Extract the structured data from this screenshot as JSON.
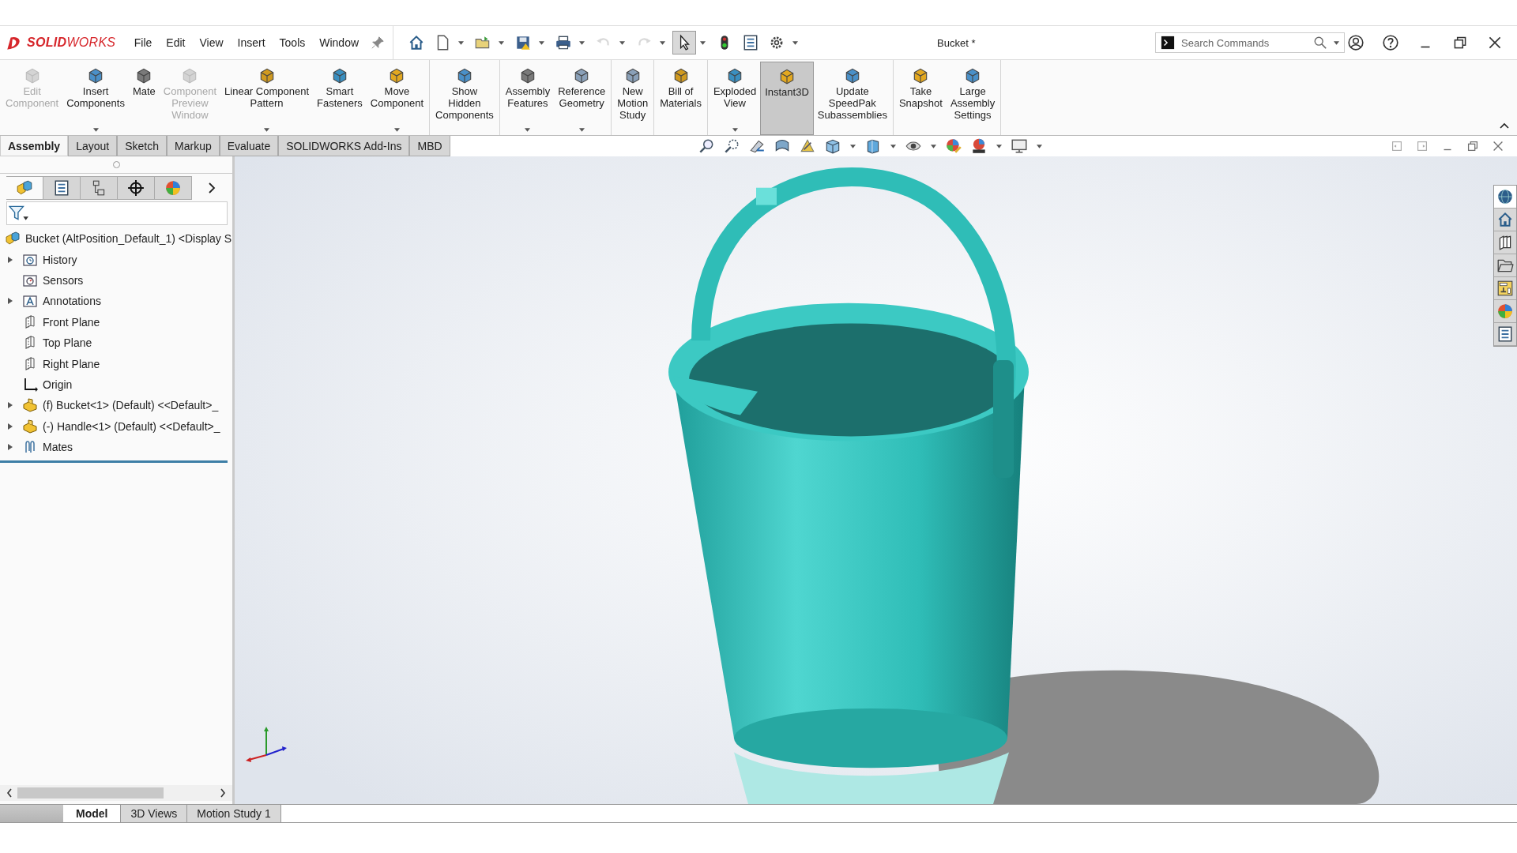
{
  "app": {
    "logo": "**SOLID**WORKS"
  },
  "menu": [
    "File",
    "Edit",
    "View",
    "Insert",
    "Tools",
    "Window"
  ],
  "quick_access": [
    {
      "kind": "home",
      "dropdown": false,
      "disabled": false,
      "selected": false
    },
    {
      "kind": "new-file",
      "dropdown": true,
      "disabled": false,
      "selected": false
    },
    {
      "kind": "open-folder",
      "dropdown": true,
      "disabled": false,
      "selected": false
    },
    {
      "kind": "save",
      "dropdown": true,
      "disabled": false,
      "selected": false
    },
    {
      "kind": "print",
      "dropdown": true,
      "disabled": false,
      "selected": false
    },
    {
      "kind": "undo",
      "dropdown": true,
      "disabled": true,
      "selected": false
    },
    {
      "kind": "redo",
      "dropdown": true,
      "disabled": true,
      "selected": false
    },
    {
      "kind": "pointer",
      "dropdown": true,
      "disabled": false,
      "selected": true
    },
    {
      "kind": "traffic-light",
      "dropdown": false,
      "disabled": false,
      "selected": false
    },
    {
      "kind": "list",
      "dropdown": false,
      "disabled": false,
      "selected": false
    },
    {
      "kind": "gear",
      "dropdown": true,
      "disabled": false,
      "selected": false
    }
  ],
  "document_title": "Bucket *",
  "search": {
    "placeholder": "Search Commands"
  },
  "window_controls": [
    {
      "kind": "user"
    },
    {
      "kind": "help"
    },
    {
      "kind": "minimize"
    },
    {
      "kind": "restore"
    },
    {
      "kind": "close"
    }
  ],
  "ribbon": {
    "groups": [
      [
        {
          "label": "Edit\nComponent",
          "disabled": true,
          "selected": false,
          "dropdown": false
        },
        {
          "label": "Insert\nComponents",
          "disabled": false,
          "selected": false,
          "dropdown": true
        },
        {
          "label": "Mate",
          "disabled": false,
          "selected": false,
          "dropdown": false
        },
        {
          "label": "Component\nPreview\nWindow",
          "disabled": true,
          "selected": false,
          "dropdown": false
        },
        {
          "label": "Linear Component\nPattern",
          "disabled": false,
          "selected": false,
          "dropdown": true
        },
        {
          "label": "Smart\nFasteners",
          "disabled": false,
          "selected": false,
          "dropdown": false
        },
        {
          "label": "Move\nComponent",
          "disabled": false,
          "selected": false,
          "dropdown": true
        }
      ],
      [
        {
          "label": "Show\nHidden\nComponents",
          "disabled": false,
          "selected": false,
          "dropdown": false
        }
      ],
      [
        {
          "label": "Assembly\nFeatures",
          "disabled": false,
          "selected": false,
          "dropdown": true
        },
        {
          "label": "Reference\nGeometry",
          "disabled": false,
          "selected": false,
          "dropdown": true
        }
      ],
      [
        {
          "label": "New\nMotion\nStudy",
          "disabled": false,
          "selected": false,
          "dropdown": false
        }
      ],
      [
        {
          "label": "Bill of\nMaterials",
          "disabled": false,
          "selected": false,
          "dropdown": false
        }
      ],
      [
        {
          "label": "Exploded\nView",
          "disabled": false,
          "selected": false,
          "dropdown": true
        },
        {
          "label": "Instant3D",
          "disabled": false,
          "selected": true,
          "dropdown": false
        },
        {
          "label": "Update\nSpeedPak\nSubassemblies",
          "disabled": false,
          "selected": false,
          "dropdown": false
        }
      ],
      [
        {
          "label": "Take\nSnapshot",
          "disabled": false,
          "selected": false,
          "dropdown": false
        },
        {
          "label": "Large\nAssembly\nSettings",
          "disabled": false,
          "selected": false,
          "dropdown": false
        }
      ]
    ]
  },
  "ribbon_tabs": [
    {
      "label": "Assembly",
      "selected": true
    },
    {
      "label": "Layout",
      "selected": false
    },
    {
      "label": "Sketch",
      "selected": false
    },
    {
      "label": "Markup",
      "selected": false
    },
    {
      "label": "Evaluate",
      "selected": false
    },
    {
      "label": "SOLIDWORKS Add-Ins",
      "selected": false
    },
    {
      "label": "MBD",
      "selected": false
    }
  ],
  "view_toolbar": [
    {
      "kind": "zoom-fit",
      "dropdown": false
    },
    {
      "kind": "zoom-area",
      "dropdown": false
    },
    {
      "kind": "previous-view",
      "dropdown": false
    },
    {
      "kind": "section-view",
      "dropdown": false
    },
    {
      "kind": "dynamic-annotation",
      "dropdown": false
    },
    {
      "kind": "view-orientation",
      "dropdown": true
    },
    {
      "kind": "display-style",
      "dropdown": true
    },
    {
      "kind": "hide-show",
      "dropdown": true
    },
    {
      "kind": "edit-appearance",
      "dropdown": false
    },
    {
      "kind": "scene",
      "dropdown": true
    },
    {
      "kind": "monitor",
      "dropdown": true
    }
  ],
  "document_controls": [
    {
      "kind": "tile-left"
    },
    {
      "kind": "tile-right"
    },
    {
      "kind": "minimize"
    },
    {
      "kind": "restore"
    },
    {
      "kind": "close"
    }
  ],
  "feature_manager": {
    "tabs": [
      {
        "kind": "assembly",
        "selected": true
      },
      {
        "kind": "list",
        "selected": false
      },
      {
        "kind": "config",
        "selected": false
      },
      {
        "kind": "crosshair",
        "selected": false
      },
      {
        "kind": "color-ball",
        "selected": false
      }
    ],
    "root": {
      "label": "Bucket (AltPosition_Default_1) <Display S",
      "kind": "assembly",
      "children": [
        {
          "label": "History",
          "kind": "history-folder",
          "expandable": true
        },
        {
          "label": "Sensors",
          "kind": "sensor-folder",
          "expandable": false
        },
        {
          "label": "Annotations",
          "kind": "annotation-folder",
          "expandable": true
        },
        {
          "label": "Front Plane",
          "kind": "plane",
          "expandable": false
        },
        {
          "label": "Top Plane",
          "kind": "plane",
          "expandable": false
        },
        {
          "label": "Right Plane",
          "kind": "plane",
          "expandable": false
        },
        {
          "label": "Origin",
          "kind": "origin",
          "expandable": false
        },
        {
          "label": "(f) Bucket<1> (Default) <<Default>_",
          "kind": "part",
          "expandable": true
        },
        {
          "label": "(-) Handle<1> (Default) <<Default>_",
          "kind": "part",
          "expandable": true
        },
        {
          "label": "Mates",
          "kind": "mates",
          "expandable": true
        }
      ]
    }
  },
  "task_pane": [
    {
      "kind": "globe",
      "selected": true
    },
    {
      "kind": "home",
      "selected": false
    },
    {
      "kind": "library",
      "selected": false
    },
    {
      "kind": "folder",
      "selected": false
    },
    {
      "kind": "palette",
      "selected": false
    },
    {
      "kind": "color-ball",
      "selected": false
    },
    {
      "kind": "list",
      "selected": false
    }
  ],
  "bottom_tabs": [
    {
      "label": "Model",
      "selected": true
    },
    {
      "label": "3D Views",
      "selected": false
    },
    {
      "label": "Motion Study 1",
      "selected": false
    }
  ]
}
